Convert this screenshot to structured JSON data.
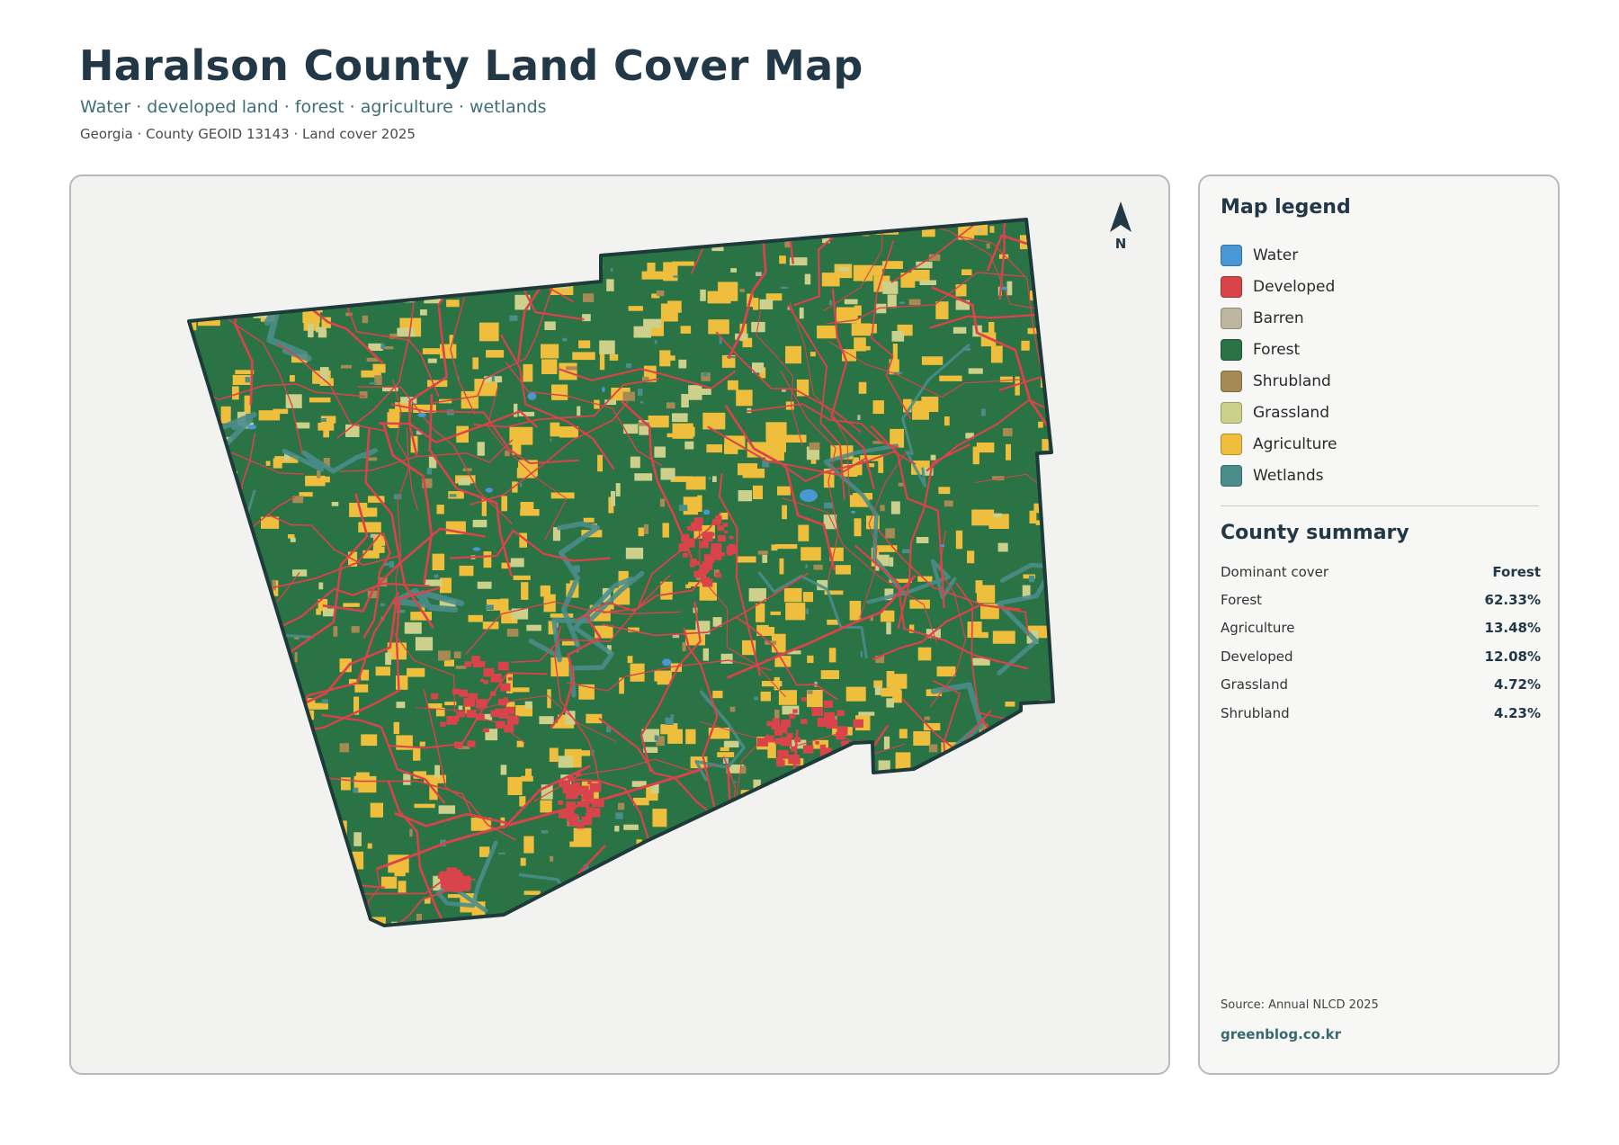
{
  "header": {
    "title": "Haralson County Land Cover Map",
    "subtitle": "Water · developed land · forest · agriculture · wetlands",
    "meta": "Georgia · County GEOID 13143 · Land cover 2025"
  },
  "map": {
    "north_label": "N",
    "colors": {
      "water": "#4a97d6",
      "developed": "#d9434a",
      "barren": "#bfb6a0",
      "forest": "#2a7345",
      "shrubland": "#a68a54",
      "grassland": "#cdd08a",
      "agriculture": "#efbe3d",
      "wetlands": "#4a8d8a",
      "boundary": "#1e3a3a",
      "background": "#f2f2f1"
    }
  },
  "legend": {
    "title": "Map legend",
    "items": [
      {
        "label": "Water",
        "color": "#4a97d6"
      },
      {
        "label": "Developed",
        "color": "#d9434a"
      },
      {
        "label": "Barren",
        "color": "#bfb6a0"
      },
      {
        "label": "Forest",
        "color": "#2a7345"
      },
      {
        "label": "Shrubland",
        "color": "#a68a54"
      },
      {
        "label": "Grassland",
        "color": "#cdd08a"
      },
      {
        "label": "Agriculture",
        "color": "#efbe3d"
      },
      {
        "label": "Wetlands",
        "color": "#4a8d8a"
      }
    ]
  },
  "summary": {
    "title": "County summary",
    "rows": [
      {
        "key": "Dominant cover",
        "value": "Forest"
      },
      {
        "key": "Forest",
        "value": "62.33%"
      },
      {
        "key": "Agriculture",
        "value": "13.48%"
      },
      {
        "key": "Developed",
        "value": "12.08%"
      },
      {
        "key": "Grassland",
        "value": "4.72%"
      },
      {
        "key": "Shrubland",
        "value": "4.23%"
      }
    ]
  },
  "footer": {
    "source": "Source: Annual NLCD 2025",
    "site": "greenblog.co.kr"
  }
}
